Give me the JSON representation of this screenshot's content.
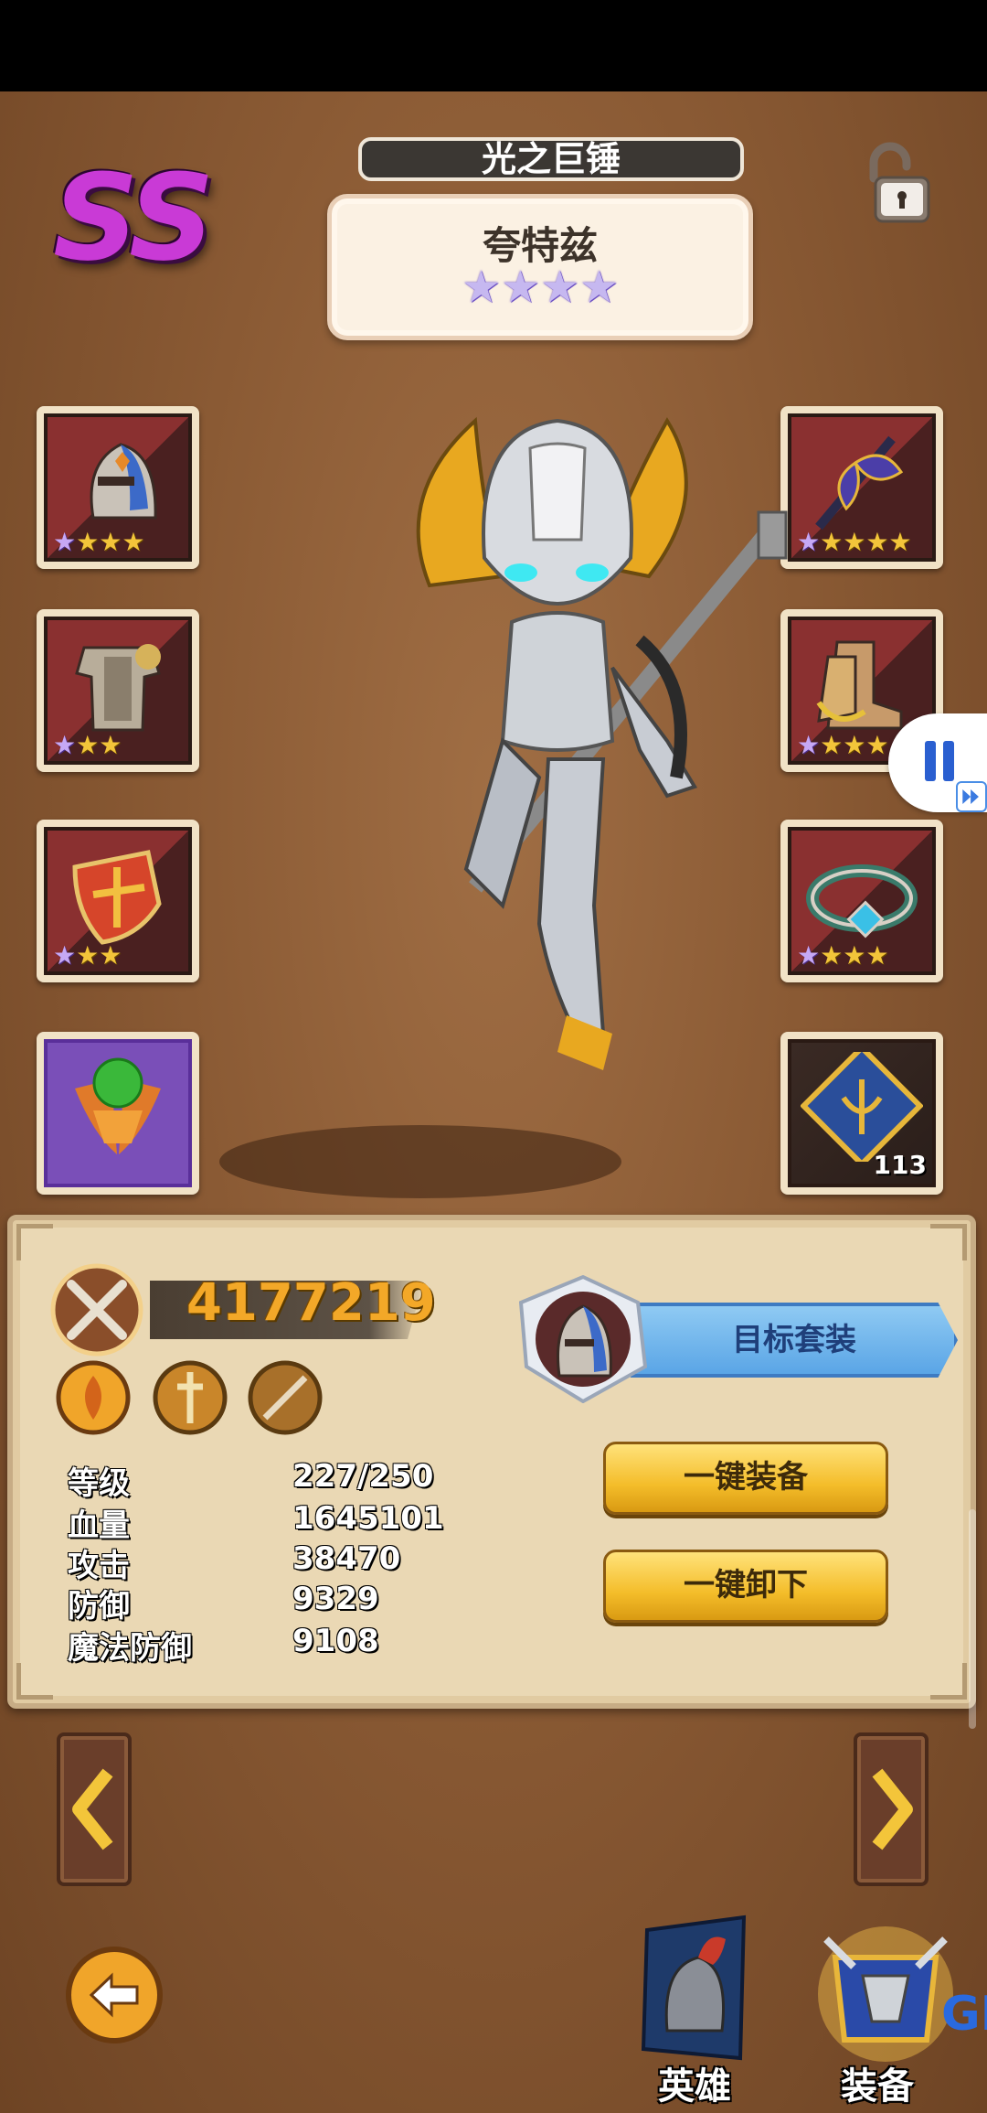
{
  "rank": "SS",
  "weapon_title": "光之巨锤",
  "hero": {
    "name": "夸特兹",
    "star_count": 4,
    "star_glyph": "★"
  },
  "equipment": {
    "left": [
      {
        "name": "helmet",
        "stars_purple": 1,
        "stars_gold": 3
      },
      {
        "name": "armor",
        "stars_purple": 1,
        "stars_gold": 2
      },
      {
        "name": "shield",
        "stars_purple": 1,
        "stars_gold": 2
      },
      {
        "name": "emblem",
        "stars_purple": 0,
        "stars_gold": 0
      }
    ],
    "right": [
      {
        "name": "axe",
        "stars_purple": 1,
        "stars_gold": 4
      },
      {
        "name": "boots",
        "stars_purple": 1,
        "stars_gold": 3
      },
      {
        "name": "belt",
        "stars_purple": 1,
        "stars_gold": 3
      },
      {
        "name": "rune",
        "count": "113"
      }
    ]
  },
  "power": "4177219",
  "stats": [
    {
      "label": "等级",
      "value": "227/250"
    },
    {
      "label": "血量",
      "value": "1645101"
    },
    {
      "label": "攻击",
      "value": "38470"
    },
    {
      "label": "防御",
      "value": "9329"
    },
    {
      "label": "魔法防御",
      "value": "9108"
    }
  ],
  "target_set_label": "目标套装",
  "buttons": {
    "equip_all": "一键装备",
    "unequip_all": "一键卸下"
  },
  "nav": {
    "hero": "英雄",
    "equip": "装备"
  },
  "watermark": "GH",
  "colors": {
    "accent_gold": "#f3a828",
    "rank_purple": "#c93ad6",
    "target_blue": "#5aa5e6"
  }
}
